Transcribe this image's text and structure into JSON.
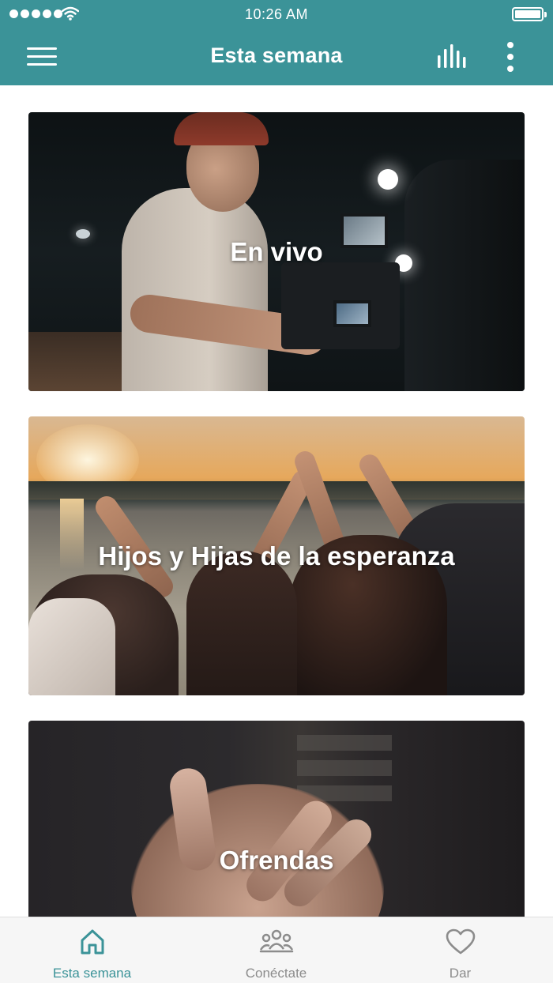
{
  "status_bar": {
    "time": "10:26 AM",
    "icons": [
      "signal-dots-icon",
      "wifi-icon",
      "battery-icon"
    ]
  },
  "nav_bar": {
    "title": "Esta semana",
    "left_icon": "menu-icon",
    "right_icons": [
      "stats-icon",
      "more-vertical-icon"
    ],
    "color": "#3b9398"
  },
  "cards": [
    {
      "title": "En vivo"
    },
    {
      "title": "Hijos y Hijas de la esperanza"
    },
    {
      "title": "Ofrendas"
    }
  ],
  "tab_bar": {
    "active_color": "#3b9398",
    "inactive_color": "#8c8c8c",
    "tabs": [
      {
        "label": "Esta semana",
        "icon": "home-icon",
        "active": true
      },
      {
        "label": "Conéctate",
        "icon": "group-icon",
        "active": false
      },
      {
        "label": "Dar",
        "icon": "heart-icon",
        "active": false
      }
    ]
  }
}
